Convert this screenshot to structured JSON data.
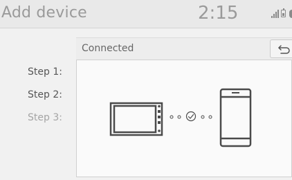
{
  "header": {
    "title": "Add device",
    "clock": "2:15",
    "status_icons": [
      "signal-icon",
      "battery-icon",
      "bluetooth-icon"
    ]
  },
  "connection": {
    "status_label": "Connected",
    "back_icon": "return-arrow-icon"
  },
  "steps": [
    {
      "label": "Step 1:",
      "state": "active"
    },
    {
      "label": "Step 2:",
      "state": "active"
    },
    {
      "label": "Step 3:",
      "state": "dimmed"
    }
  ],
  "illustration": {
    "left_device": "head-unit-icon",
    "link": "pairing-dots-with-check-icon",
    "right_device": "smartphone-icon"
  },
  "colors": {
    "text_primary": "#555555",
    "text_dimmed": "#a4a4a4",
    "title_gray": "#9a9a9a",
    "icon_gray": "#4a4a4a"
  }
}
